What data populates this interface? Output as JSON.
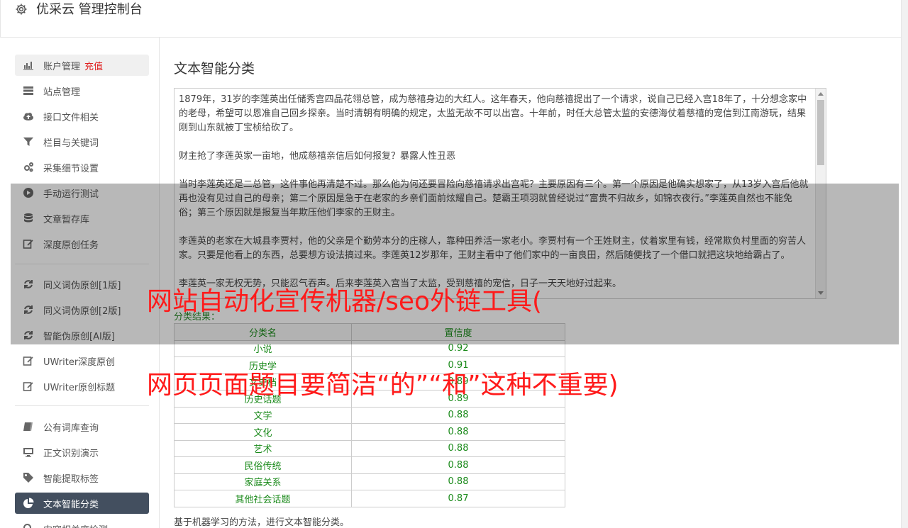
{
  "header": {
    "title": "优采云 管理控制台",
    "icon": "gear-icon"
  },
  "sidebar": {
    "items": [
      {
        "label": "账户管理",
        "badge": "充值",
        "icon": "bar-chart-icon"
      },
      {
        "label": "站点管理",
        "icon": "server-icon"
      },
      {
        "label": "接口文件相关",
        "icon": "cloud-upload-icon"
      },
      {
        "label": "栏目与关键词",
        "icon": "filter-icon"
      },
      {
        "label": "采集细节设置",
        "icon": "cogs-icon"
      },
      {
        "label": "手动运行测试",
        "icon": "play-circle-icon"
      },
      {
        "label": "文章暂存库",
        "icon": "database-icon"
      },
      {
        "label": "深度原创任务",
        "icon": "edit-icon"
      },
      {
        "label": "同义词伪原创[1版]",
        "icon": "refresh-icon"
      },
      {
        "label": "同义词伪原创[2版]",
        "icon": "refresh-icon"
      },
      {
        "label": "智能伪原创[AI版]",
        "icon": "refresh-icon"
      },
      {
        "label": "UWriter深度原创",
        "icon": "edit-icon"
      },
      {
        "label": "UWriter原创标题",
        "icon": "edit-icon"
      },
      {
        "label": "公有词库查询",
        "icon": "book-icon"
      },
      {
        "label": "正文识别演示",
        "icon": "monitor-icon"
      },
      {
        "label": "智能提取标签",
        "icon": "tag-icon"
      },
      {
        "label": "文本智能分类",
        "icon": "pie-chart-icon"
      },
      {
        "label": "内容相关度检测",
        "icon": "search-icon"
      }
    ]
  },
  "main": {
    "title": "文本智能分类",
    "article": [
      "1879年，31岁的李莲英出任储秀宫四品花翎总管，成为慈禧身边的大红人。这年春天，他向慈禧提出了一个请求，说自己已经入宫18年了，十分想念家中的老母，希望可以恩准自己回乡探亲。当时清朝有明确的规定，太监无故不可以出宫。十年前，时任大总管太监的安德海仗着慈禧的宠信到江南游玩，结果刚到山东就被丁宝桢给砍了。",
      "财主抢了李莲英家一亩地，他成慈禧亲信后如何报复？暴露人性丑恶",
      "当时李莲英还是二总管，这件事他再清楚不过。那么他为何还要冒险向慈禧请求出宫呢？主要原因有三个。第一个原因是他确实想家了，从13岁入宫后他就再也没有见过自己的母亲；第二个原因是急于在老家的乡亲们面前炫耀自己。楚霸王项羽就曾经说过“富贵不归故乡，如锦衣夜行。”李莲英自然也不能免俗；第三个原因就是报复当年欺压他们李家的王财主。",
      "李莲英的老家在大城县李贾村，他的父亲是个勤劳本分的庄稼人，靠种田养活一家老小。李贾村有一个王姓财主，仗着家里有钱，经常欺负村里面的穷苦人家。只要是他看上的东西，总要想方设法搞过来。李莲英12岁那年，王财主看中了他们家中的一亩良田，然后随便找了一个借口就把这块地给霸占了。",
      "李莲英一家无权无势，只能忍气吞声。后来李莲英入宫当了太监，受到慈禧的宠信，日子一天天地好过起来。"
    ],
    "result_label": "分类结果：",
    "table": {
      "headers": [
        "分类名",
        "置信度"
      ],
      "rows": [
        [
          "小说",
          "0.92"
        ],
        [
          "历史学",
          "0.91"
        ],
        [
          "文史档",
          "0.89"
        ],
        [
          "历史话题",
          "0.89"
        ],
        [
          "文学",
          "0.88"
        ],
        [
          "文化",
          "0.88"
        ],
        [
          "艺术",
          "0.88"
        ],
        [
          "民俗传统",
          "0.88"
        ],
        [
          "家庭关系",
          "0.88"
        ],
        [
          "其他社会话题",
          "0.87"
        ]
      ]
    },
    "footnote": "基于机器学习的方法，进行文本智能分类。"
  },
  "watermark": {
    "line1": "网站自动化宣传机器/seo外链工具(",
    "line2": "网页页面题目要简洁“的”“和”这种不重要)"
  },
  "colors": {
    "active_nav": "#434f5f",
    "badge": "#e02020",
    "result_green": "#1a8a1a",
    "watermark": "#ff1a1a"
  }
}
